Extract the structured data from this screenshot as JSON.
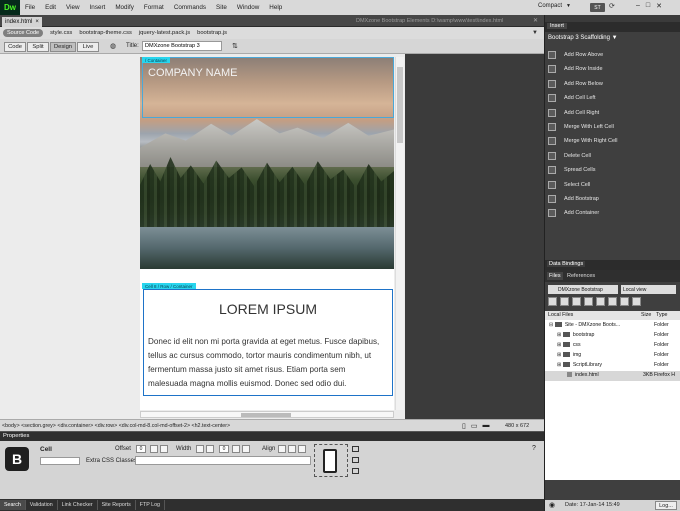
{
  "app": {
    "logo": "Dw",
    "workspace": "Compact",
    "badge": "ST"
  },
  "menu": [
    "File",
    "Edit",
    "View",
    "Insert",
    "Modify",
    "Format",
    "Commands",
    "Site",
    "Window",
    "Help"
  ],
  "document": {
    "tab": "index.html",
    "path": "DMXzone Bootstrap Elements   D:\\wamp\\www\\test\\index.html",
    "related_files": [
      "Source Code",
      "style.css",
      "bootstrap-theme.css",
      "jquery-latest.pack.js",
      "bootstrap.js"
    ],
    "view_buttons": [
      "Code",
      "Split",
      "Design",
      "Live"
    ],
    "title_label": "Title:",
    "title_value": "DMXzone Bootstrap 3"
  },
  "design": {
    "hero_tag": "/ Container",
    "company": "COMPANY NAME",
    "lorem_tag": "Cell 8  / Row / Container",
    "lorem_title": "LOREM IPSUM",
    "lorem_text": "Donec id elit non mi porta gravida at eget metus. Fusce dapibus, tellus ac cursus commodo, tortor mauris condimentum nibh, ut fermentum massa justo sit amet risus. Etiam porta sem malesuada magna mollis euismod. Donec sed odio dui."
  },
  "status": {
    "tag_selector": "<body> <section.grey> <div.container> <div.row> <div.col-md-8.col-md-offset-2> <h2.text-center>",
    "size": "480 x 672"
  },
  "properties": {
    "tab": "Properties",
    "element": "Cell",
    "offset_label": "Offset",
    "offset_value": "0",
    "width_label": "Width",
    "width_value": "0",
    "align_label": "Align",
    "extra_css_label": "Extra CSS Classes"
  },
  "bottom_tabs": [
    "Search",
    "Validation",
    "Link Checker",
    "Site Reports",
    "FTP Log"
  ],
  "insert": {
    "tab": "Insert",
    "category": "Bootstrap 3 Scaffolding",
    "items": [
      "Add Row Above",
      "Add Row Inside",
      "Add Row Below",
      "Add Cell Left",
      "Add Cell Right",
      "Merge With Left Cell",
      "Merge With Right Cell",
      "Delete Cell",
      "Spread Cells",
      "Select Cell",
      "Add Bootstrap",
      "Add Container"
    ]
  },
  "panels": {
    "data_bindings": "Data Bindings",
    "files": "Files",
    "references": "References"
  },
  "files": {
    "site": "DMXzone Bootstrap",
    "view": "Local view",
    "headers": [
      "Local Files",
      "Size",
      "Type"
    ],
    "rows": [
      {
        "name": "Site - DMXzone Boots...",
        "size": "",
        "type": "Folder"
      },
      {
        "name": "bootstrap",
        "size": "",
        "type": "Folder"
      },
      {
        "name": "css",
        "size": "",
        "type": "Folder"
      },
      {
        "name": "img",
        "size": "",
        "type": "Folder"
      },
      {
        "name": "ScriptLibrary",
        "size": "",
        "type": "Folder"
      },
      {
        "name": "index.html",
        "size": "3KB",
        "type": "Firefox H"
      }
    ],
    "date": "Date: 17-Jan-14 15:49",
    "log": "Log..."
  }
}
